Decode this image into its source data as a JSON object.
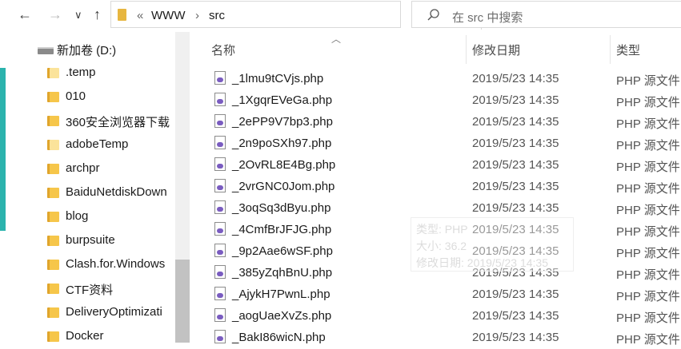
{
  "nav_buttons": {
    "back": "←",
    "forward": "→",
    "recent": "∨",
    "up": "↑"
  },
  "address": {
    "overflow": "«",
    "crumbs": [
      "WWW",
      "src"
    ],
    "separator": "›"
  },
  "search": {
    "placeholder": "在 src 中搜索"
  },
  "sidebar": {
    "drive": "新加卷 (D:)",
    "items": [
      ".temp",
      "010",
      "360安全浏览器下载",
      "adobeTemp",
      "archpr",
      "BaiduNetdiskDown",
      "blog",
      "burpsuite",
      "Clash.for.Windows",
      "CTF资料",
      "DeliveryOptimizati",
      "Docker"
    ]
  },
  "columns": {
    "name": "名称",
    "date": "修改日期",
    "type": "类型"
  },
  "files": [
    {
      "name": "_1lmu9tCVjs.php",
      "date": "2019/5/23 14:35",
      "type": "PHP 源文件"
    },
    {
      "name": "_1XgqrEVeGa.php",
      "date": "2019/5/23 14:35",
      "type": "PHP 源文件"
    },
    {
      "name": "_2ePP9V7bp3.php",
      "date": "2019/5/23 14:35",
      "type": "PHP 源文件"
    },
    {
      "name": "_2n9poSXh97.php",
      "date": "2019/5/23 14:35",
      "type": "PHP 源文件"
    },
    {
      "name": "_2OvRL8E4Bg.php",
      "date": "2019/5/23 14:35",
      "type": "PHP 源文件"
    },
    {
      "name": "_2vrGNC0Jom.php",
      "date": "2019/5/23 14:35",
      "type": "PHP 源文件"
    },
    {
      "name": "_3oqSq3dByu.php",
      "date": "2019/5/23 14:35",
      "type": "PHP 源文件"
    },
    {
      "name": "_4CmfBrJFJG.php",
      "date": "2019/5/23 14:35",
      "type": "PHP 源文件"
    },
    {
      "name": "_9p2Aae6wSF.php",
      "date": "2019/5/23 14:35",
      "type": "PHP 源文件"
    },
    {
      "name": "_385yZqhBnU.php",
      "date": "2019/5/23 14:35",
      "type": "PHP 源文件"
    },
    {
      "name": "_AjykH7PwnL.php",
      "date": "2019/5/23 14:35",
      "type": "PHP 源文件"
    },
    {
      "name": "_aogUaeXvZs.php",
      "date": "2019/5/23 14:35",
      "type": "PHP 源文件"
    },
    {
      "name": "_BakI86wicN.php",
      "date": "2019/5/23 14:35",
      "type": "PHP 源文件"
    }
  ],
  "tooltip": {
    "type": "类型: PHP",
    "size": "大小: 36.2",
    "modified": "修改日期: 2019/5/23 14:35"
  }
}
